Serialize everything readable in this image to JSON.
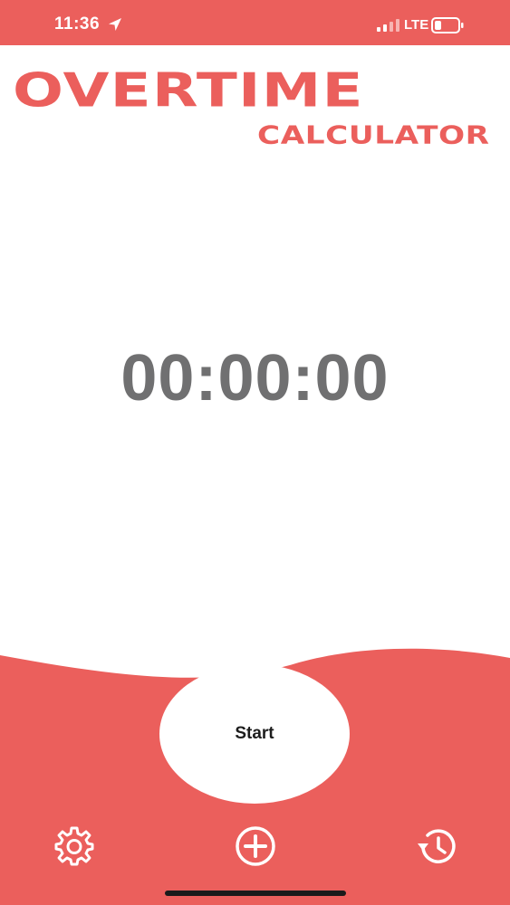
{
  "status_bar": {
    "time": "11:36",
    "network": "LTE",
    "location_icon": "location-arrow-icon",
    "signal_icon": "cellular-signal-icon",
    "battery_icon": "battery-icon"
  },
  "app": {
    "title": "OVERTIME",
    "subtitle": "CALCULATOR"
  },
  "timer": {
    "display": "00:00:00"
  },
  "actions": {
    "start_label": "Start"
  },
  "bottom_nav": {
    "items": [
      {
        "icon": "gear-icon"
      },
      {
        "icon": "plus-circle-icon"
      },
      {
        "icon": "history-clock-icon"
      }
    ]
  },
  "colors": {
    "accent": "#eb5f5c",
    "timer_text": "#707071",
    "background": "#ffffff"
  }
}
